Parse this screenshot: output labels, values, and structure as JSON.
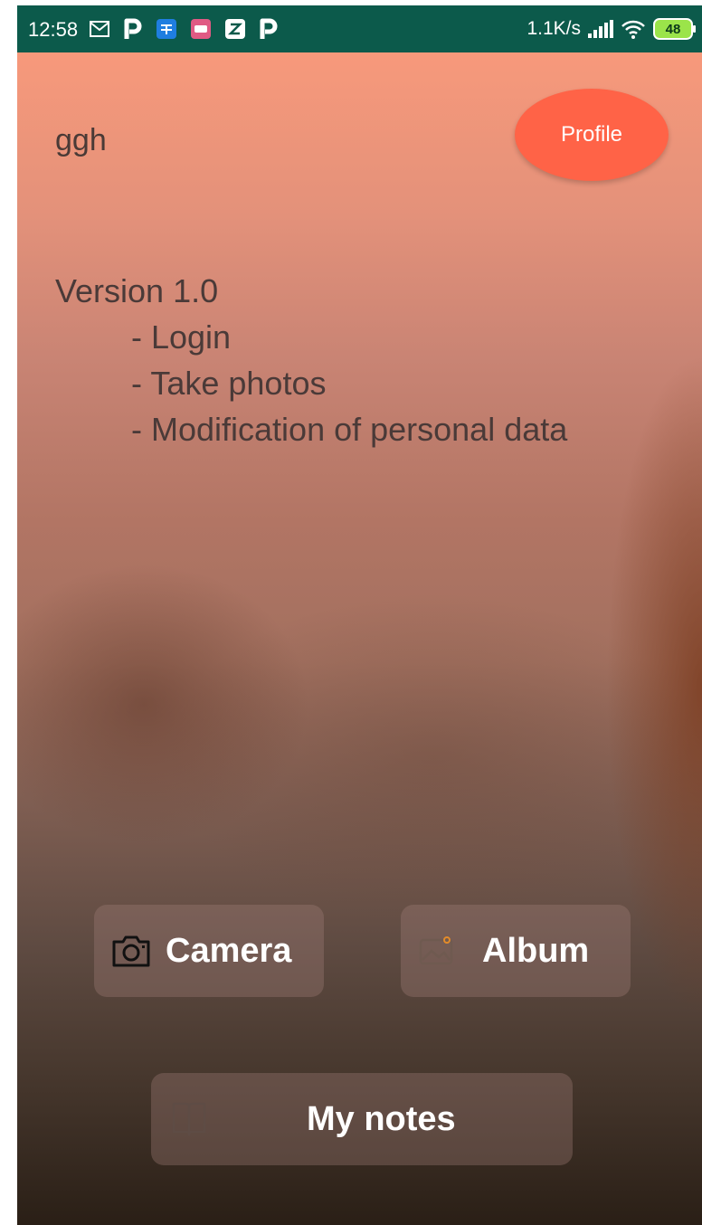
{
  "status_bar": {
    "time": "12:58",
    "network_speed": "1.1K/s",
    "battery_level": "48",
    "left_icons": [
      "mail-icon",
      "p-app-icon",
      "zhihu-app-icon",
      "pink-app-icon",
      "z-app-icon",
      "p-app-icon"
    ],
    "right_icons": [
      "signal-icon",
      "wifi-icon",
      "battery-icon"
    ],
    "colors": {
      "background": "#0c5a4b",
      "battery_fill": "#9be44a"
    }
  },
  "header": {
    "username": "ggh",
    "profile_label": "Profile"
  },
  "release_notes": {
    "version": "Version 1.0",
    "items": [
      "- Login",
      "- Take photos",
      "- Modification of personal data"
    ]
  },
  "actions": {
    "camera_label": "Camera",
    "album_label": "Album",
    "notes_label": "My notes"
  },
  "colors": {
    "profile_button": "#ff6347",
    "background_top": "#f7997b",
    "background_bottom": "#2a1f16",
    "text": "#4a3a38"
  }
}
